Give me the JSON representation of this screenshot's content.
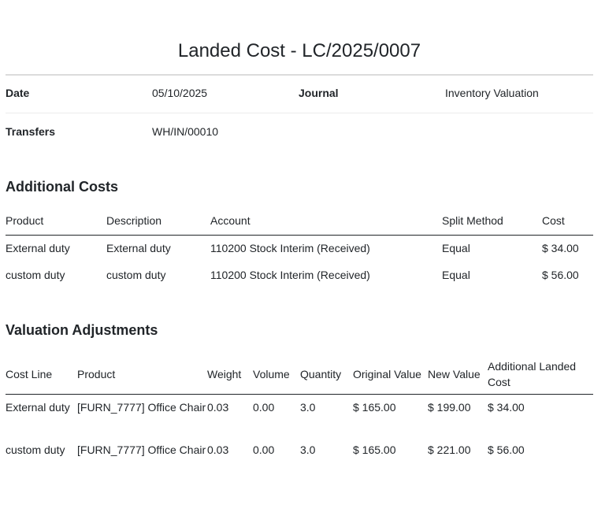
{
  "title": "Landed Cost - LC/2025/0007",
  "info": {
    "date_label": "Date",
    "date_value": "05/10/2025",
    "journal_label": "Journal",
    "journal_value": "Inventory Valuation",
    "transfers_label": "Transfers",
    "transfers_value": "WH/IN/00010"
  },
  "additional_costs": {
    "heading": "Additional Costs",
    "columns": [
      "Product",
      "Description",
      "Account",
      "Split Method",
      "Cost"
    ],
    "rows": [
      [
        "External duty",
        "External duty",
        "110200 Stock Interim (Received)",
        "Equal",
        "$ 34.00"
      ],
      [
        "custom duty",
        "custom duty",
        "110200 Stock Interim (Received)",
        "Equal",
        "$ 56.00"
      ]
    ]
  },
  "valuation_adjustments": {
    "heading": "Valuation Adjustments",
    "columns": [
      "Cost Line",
      "Product",
      "Weight",
      "Volume",
      "Quantity",
      "Original Value",
      "New Value",
      "Additional Landed Cost"
    ],
    "rows": [
      [
        "External duty",
        "[FURN_7777] Office Chair",
        "0.03",
        "0.00",
        "3.0",
        "$ 165.00",
        "$ 199.00",
        "$ 34.00"
      ],
      [
        "custom duty",
        "[FURN_7777] Office Chair",
        "0.03",
        "0.00",
        "3.0",
        "$ 165.00",
        "$ 221.00",
        "$ 56.00"
      ]
    ]
  }
}
